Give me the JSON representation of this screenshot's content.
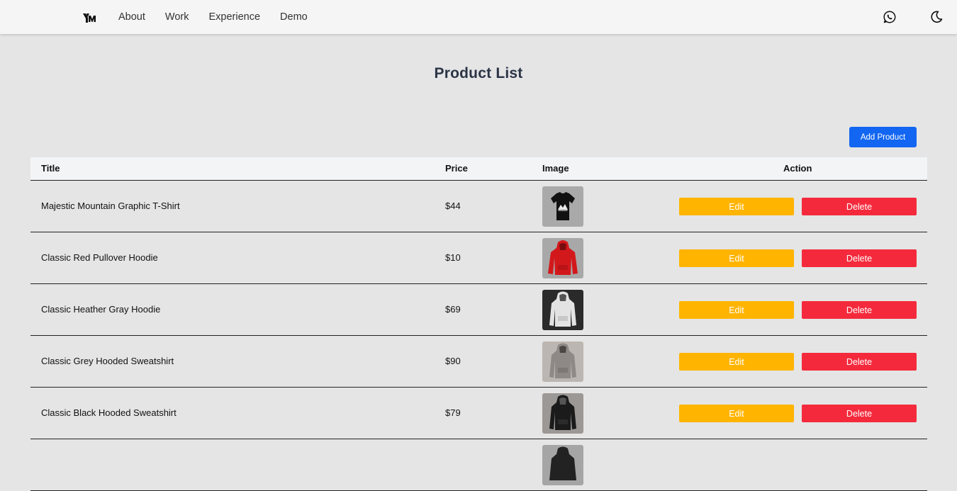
{
  "nav": {
    "logo_text": "YM",
    "links": [
      "About",
      "Work",
      "Experience",
      "Demo"
    ],
    "icons": [
      "whatsapp-icon",
      "moon-icon"
    ]
  },
  "page": {
    "title": "Product List",
    "add_button": "Add Product"
  },
  "table": {
    "headers": {
      "title": "Title",
      "price": "Price",
      "image": "Image",
      "action": "Action"
    },
    "edit_label": "Edit",
    "delete_label": "Delete",
    "rows": [
      {
        "title": "Majestic Mountain Graphic T-Shirt",
        "price": "$44",
        "image": "black-tshirt"
      },
      {
        "title": "Classic Red Pullover Hoodie",
        "price": "$10",
        "image": "red-hoodie"
      },
      {
        "title": "Classic Heather Gray Hoodie",
        "price": "$69",
        "image": "gray-hoodie"
      },
      {
        "title": "Classic Grey Hooded Sweatshirt",
        "price": "$90",
        "image": "grey-sweatshirt"
      },
      {
        "title": "Classic Black Hooded Sweatshirt",
        "price": "$79",
        "image": "black-sweatshirt"
      }
    ]
  },
  "colors": {
    "add_button": "#1266f1",
    "edit_button": "#ffb400",
    "delete_button": "#f42a3c",
    "background": "#e5e5e5",
    "header_bg": "#f3f4f6"
  }
}
